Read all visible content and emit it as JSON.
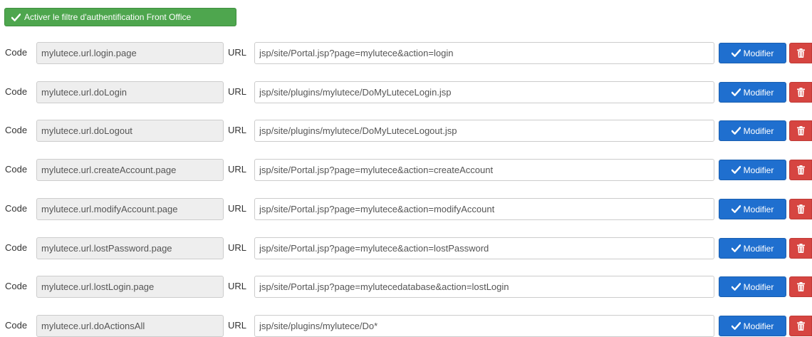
{
  "toolbar": {
    "activate_filter_label": "Activer le filtre d'authentification Front Office",
    "activate_icon": "check-icon"
  },
  "labels": {
    "code": "Code",
    "url": "URL"
  },
  "buttons": {
    "modify_label": "Modifier",
    "modify_icon": "check-icon",
    "delete_icon": "trash-icon"
  },
  "colors": {
    "success_green": "#4ea64e",
    "primary_blue": "#1f6fcf",
    "danger_red": "#d64541"
  },
  "rows": [
    {
      "code": "mylutece.url.login.page",
      "url": "jsp/site/Portal.jsp?page=mylutece&action=login"
    },
    {
      "code": "mylutece.url.doLogin",
      "url": "jsp/site/plugins/mylutece/DoMyLuteceLogin.jsp"
    },
    {
      "code": "mylutece.url.doLogout",
      "url": "jsp/site/plugins/mylutece/DoMyLuteceLogout.jsp"
    },
    {
      "code": "mylutece.url.createAccount.page",
      "url": "jsp/site/Portal.jsp?page=mylutece&action=createAccount"
    },
    {
      "code": "mylutece.url.modifyAccount.page",
      "url": "jsp/site/Portal.jsp?page=mylutece&action=modifyAccount"
    },
    {
      "code": "mylutece.url.lostPassword.page",
      "url": "jsp/site/Portal.jsp?page=mylutece&action=lostPassword"
    },
    {
      "code": "mylutece.url.lostLogin.page",
      "url": "jsp/site/Portal.jsp?page=mylutecedatabase&action=lostLogin"
    },
    {
      "code": "mylutece.url.doActionsAll",
      "url": "jsp/site/plugins/mylutece/Do*"
    }
  ]
}
